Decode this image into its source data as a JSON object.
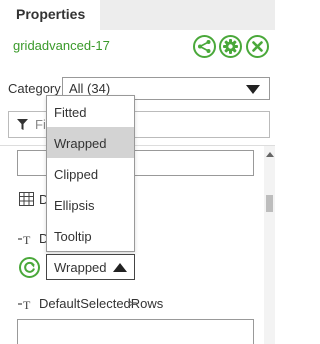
{
  "panel": {
    "tab_label": "Properties",
    "control_name": "gridadvanced-17",
    "accent_color": "#4aa83a"
  },
  "header_buttons": [
    {
      "icon": "share-icon"
    },
    {
      "icon": "gear-icon"
    },
    {
      "icon": "close-icon"
    }
  ],
  "category": {
    "label": "Category",
    "value": "All (34)"
  },
  "filter": {
    "placeholder": "Fil"
  },
  "properties": {
    "row_d1_label": "D",
    "row_d2_label": "D",
    "default_selected_rows_label": "DefaultSelectedRows",
    "link_symbol": "⇦"
  },
  "dropdown": {
    "options": [
      "Fitted",
      "Wrapped",
      "Clipped",
      "Ellipsis",
      "Tooltip"
    ],
    "selected": "Wrapped"
  }
}
